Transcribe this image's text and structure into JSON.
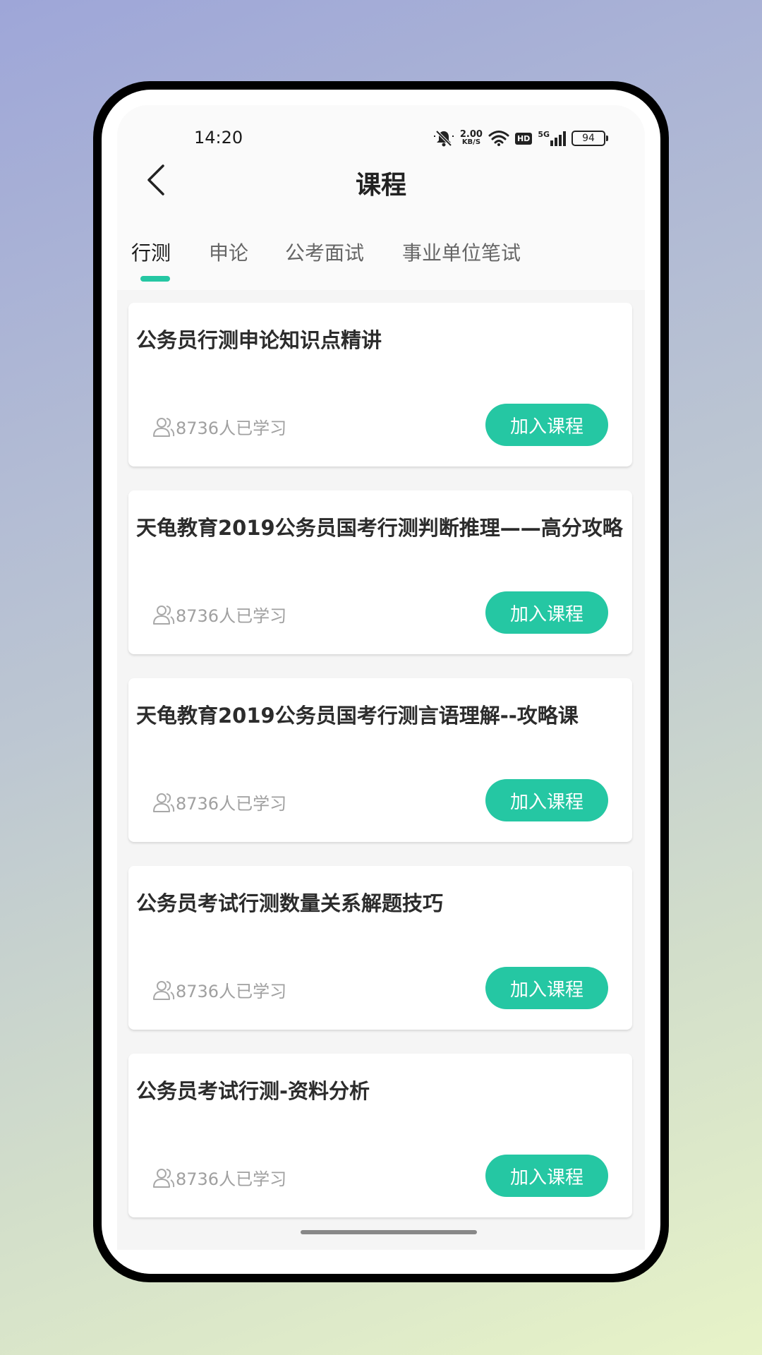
{
  "status_bar": {
    "time": "14:20",
    "net_speed_value": "2.00",
    "net_speed_unit": "KB/S",
    "hd_label": "HD",
    "network_label": "5G",
    "battery": "94"
  },
  "header": {
    "title": "课程"
  },
  "tabs": [
    {
      "label": "行测",
      "active": true
    },
    {
      "label": "申论",
      "active": false
    },
    {
      "label": "公考面试",
      "active": false
    },
    {
      "label": "事业单位笔试",
      "active": false
    }
  ],
  "courses": [
    {
      "title": "公务员行测申论知识点精讲",
      "learners": "8736人已学习",
      "button": "加入课程"
    },
    {
      "title": "天龟教育2019公务员国考行测判断推理——高分攻略",
      "learners": "8736人已学习",
      "button": "加入课程"
    },
    {
      "title": "天龟教育2019公务员国考行测言语理解--攻略课",
      "learners": "8736人已学习",
      "button": "加入课程"
    },
    {
      "title": "公务员考试行测数量关系解题技巧",
      "learners": "8736人已学习",
      "button": "加入课程"
    },
    {
      "title": "公务员考试行测-资料分析",
      "learners": "8736人已学习",
      "button": "加入课程"
    }
  ],
  "colors": {
    "accent": "#25c7a3",
    "title_text": "#2c2c2c",
    "muted_text": "#a0a0a0"
  }
}
